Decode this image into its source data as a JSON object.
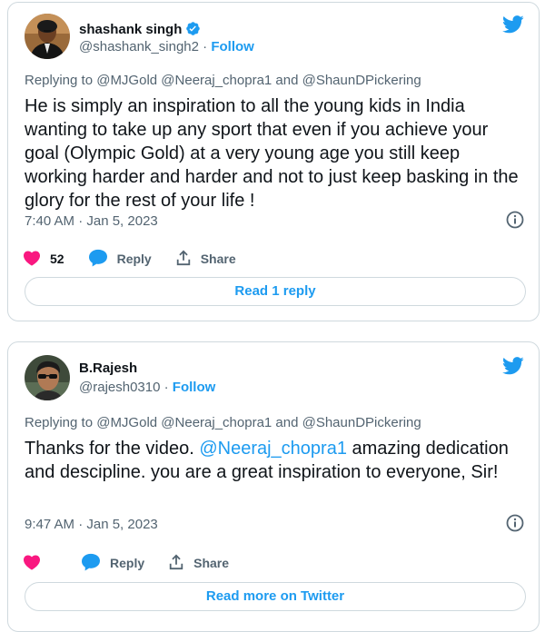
{
  "tweets": [
    {
      "author_name": "shashank singh",
      "handle": "@shashank_singh2",
      "separator": "·",
      "follow_label": "Follow",
      "verified": true,
      "replying_to": "Replying to @MJGold @Neeraj_chopra1 and @ShaunDPickering",
      "text": "He is simply an inspiration to all the young kids in India wanting to take up any sport that even if you achieve your goal (Olympic Gold) at a very young age you still keep working harder and harder and not to just keep basking in the glory for the rest of your life !",
      "timestamp": "7:40 AM · Jan 5, 2023",
      "like_count": "52",
      "reply_label": "Reply",
      "share_label": "Share",
      "button_label": "Read 1 reply"
    },
    {
      "author_name": "B.Rajesh",
      "handle": "@rajesh0310",
      "separator": "·",
      "follow_label": "Follow",
      "verified": false,
      "replying_to": "Replying to @MJGold @Neeraj_chopra1 and @ShaunDPickering",
      "text_before": "Thanks for the video. ",
      "text_mention": "@Neeraj_chopra1",
      "text_after": " amazing dedication and descipline. you are a great inspiration to everyone, Sir!",
      "timestamp": "9:47 AM · Jan 5, 2023",
      "like_count": "",
      "reply_label": "Reply",
      "share_label": "Share",
      "button_label": "Read more on Twitter"
    }
  ],
  "colors": {
    "accent": "#1d9bf0",
    "like": "#f91880",
    "border": "#cfd9de",
    "secondary_text": "#536471"
  },
  "icons": [
    "twitter-bird-icon",
    "verified-badge-icon",
    "info-icon",
    "heart-icon",
    "reply-bubble-icon",
    "share-icon"
  ]
}
